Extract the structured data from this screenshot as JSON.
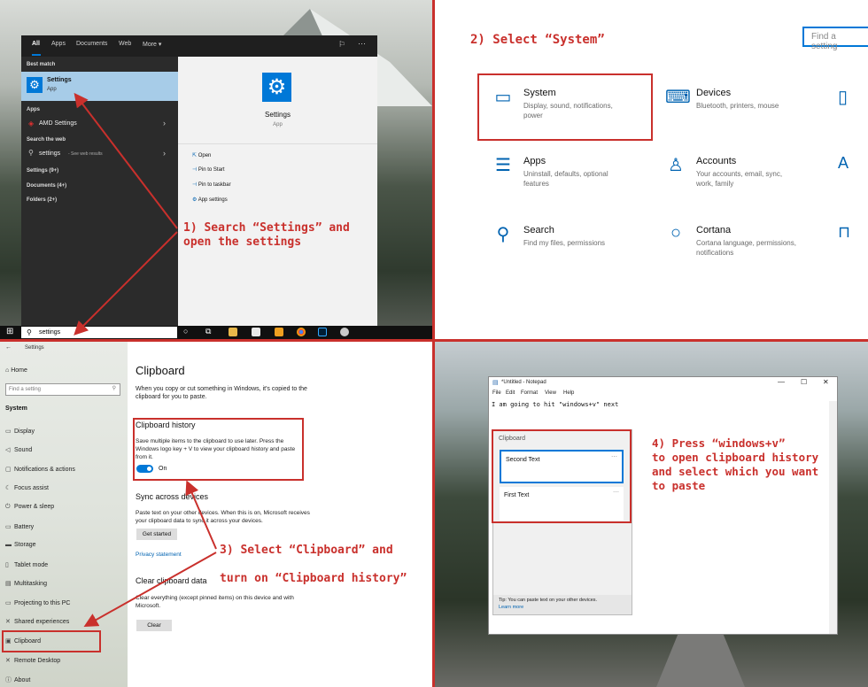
{
  "q1": {
    "tabs": [
      "All",
      "Apps",
      "Documents",
      "Web",
      "More ▾"
    ],
    "best_match_label": "Best match",
    "best_match_title": "Settings",
    "best_match_sub": "App",
    "apps_label": "Apps",
    "amd_item": "AMD Settings",
    "search_web_label": "Search the web",
    "web_item": "settings",
    "web_item_sub": "- See web results",
    "settings_count": "Settings (9+)",
    "documents_count": "Documents (4+)",
    "folders_count": "Folders (2+)",
    "preview_title": "Settings",
    "preview_sub": "App",
    "actions": [
      "Open",
      "Pin to Start",
      "Pin to taskbar",
      "App settings"
    ],
    "search_value": "settings",
    "instruction": "1) Search “Settings” and\nopen the settings"
  },
  "q2": {
    "instruction": "2) Select “System”",
    "search_placeholder": "Find a setting",
    "items": [
      {
        "title": "System",
        "desc": "Display, sound, notifications, power",
        "icon": "laptop-icon"
      },
      {
        "title": "Devices",
        "desc": "Bluetooth, printers, mouse",
        "icon": "devices-icon"
      },
      {
        "title": "Apps",
        "desc": "Uninstall, defaults, optional features",
        "icon": "apps-list-icon"
      },
      {
        "title": "Accounts",
        "desc": "Your accounts, email, sync, work, family",
        "icon": "person-icon"
      },
      {
        "title": "Search",
        "desc": "Find my files, permissions",
        "icon": "search-icon"
      },
      {
        "title": "Cortana",
        "desc": "Cortana language, permissions, notifications",
        "icon": "cortana-icon"
      }
    ]
  },
  "q3": {
    "window_title": "Settings",
    "home": "Home",
    "find_placeholder": "Find a setting",
    "section": "System",
    "sidebar_items": [
      "Display",
      "Sound",
      "Notifications & actions",
      "Focus assist",
      "Power & sleep",
      "Battery",
      "Storage",
      "Tablet mode",
      "Multitasking",
      "Projecting to this PC",
      "Shared experiences",
      "Clipboard",
      "Remote Desktop",
      "About"
    ],
    "page_title": "Clipboard",
    "intro": "When you copy or cut something in Windows, it's copied to the clipboard for you to paste.",
    "history_title": "Clipboard history",
    "history_desc": "Save multiple items to the clipboard to use later. Press the Windows logo key + V to view your clipboard history and paste from it.",
    "toggle_label": "On",
    "sync_title": "Sync across devices",
    "sync_desc": "Paste text on your other devices. When this is on, Microsoft receives your clipboard data to sync it across your devices.",
    "get_started": "Get started",
    "privacy": "Privacy statement",
    "clear_title": "Clear clipboard data",
    "clear_desc": "Clear everything (except pinned items) on this device and with Microsoft.",
    "clear_button": "Clear",
    "instruction1": "3) Select “Clipboard” and",
    "instruction2": "turn on “Clipboard history”"
  },
  "q4": {
    "window_title": "*Untitled - Notepad",
    "menu": [
      "File",
      "Edit",
      "Format",
      "View",
      "Help"
    ],
    "text": "I am going to hit \"windows+v\" next",
    "panel_title": "Clipboard",
    "items": [
      "Second Text",
      "First Text"
    ],
    "tip": "Tip: You can paste text on your other devices.",
    "learn_more": "Learn more",
    "instruction": "4) Press “windows+v”\nto open clipboard history\nand select which you want\nto paste"
  }
}
